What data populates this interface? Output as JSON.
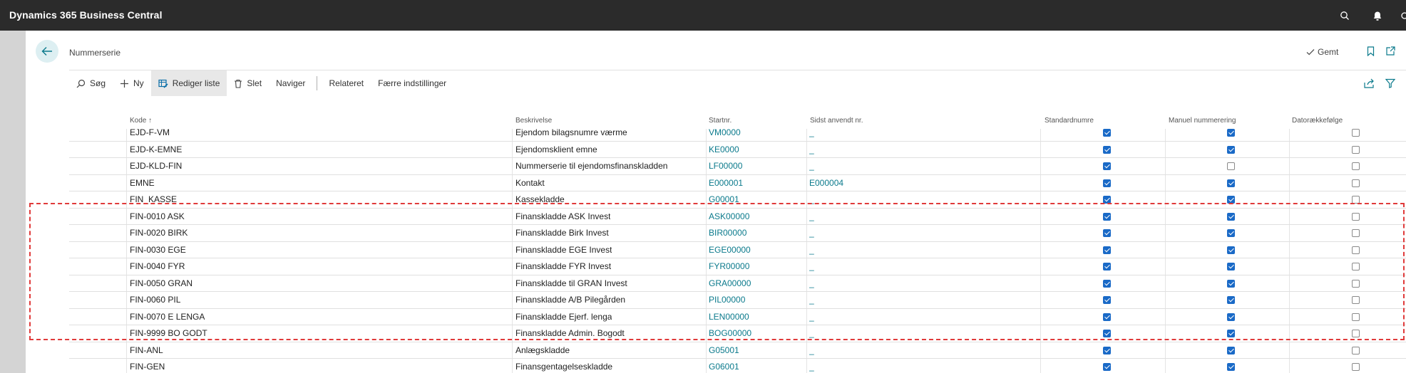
{
  "app": {
    "title": "Dynamics 365 Business Central"
  },
  "topbar_icons": [
    "search-icon",
    "bell-icon",
    "more-icon"
  ],
  "page": {
    "title": "Nummerserie",
    "saved_label": "Gemt"
  },
  "actions": {
    "search": "Søg",
    "new": "Ny",
    "edit_list": "Rediger liste",
    "delete": "Slet",
    "navigate": "Naviger",
    "related": "Relateret",
    "fewer_options": "Færre indstillinger"
  },
  "columns": {
    "code": "Kode",
    "sort_indicator": "↑",
    "description": "Beskrivelse",
    "start_no": "Startnr.",
    "last_used": "Sidst anvendt nr.",
    "default_nos": "Standardnumre",
    "manual_nos": "Manuel nummerering",
    "date_order": "Datorækkefølge"
  },
  "rows": [
    {
      "code": "EJD-F-VM",
      "description": "Ejendom bilagsnumre værme",
      "start_no": "VM0000",
      "last_used": "_",
      "default": true,
      "manual": true,
      "date_order": false
    },
    {
      "code": "EJD-K-EMNE",
      "description": "Ejendomsklient emne",
      "start_no": "KE0000",
      "last_used": "_",
      "default": true,
      "manual": true,
      "date_order": false
    },
    {
      "code": "EJD-KLD-FIN",
      "description": "Nummerserie til ejendomsfinanskladden",
      "start_no": "LF00000",
      "last_used": "_",
      "default": true,
      "manual": false,
      "date_order": false
    },
    {
      "code": "EMNE",
      "description": "Kontakt",
      "start_no": "E000001",
      "last_used": "E000004",
      "default": true,
      "manual": true,
      "date_order": false
    },
    {
      "code": "FIN_KASSE",
      "description": "Kassekladde",
      "start_no": "G00001",
      "last_used": "_",
      "default": true,
      "manual": true,
      "date_order": false
    },
    {
      "code": "FIN-0010 ASK",
      "description": "Finanskladde ASK Invest",
      "start_no": "ASK00000",
      "last_used": "_",
      "default": true,
      "manual": true,
      "date_order": false
    },
    {
      "code": "FIN-0020 BIRK",
      "description": "Finanskladde Birk Invest",
      "start_no": "BIR00000",
      "last_used": "_",
      "default": true,
      "manual": true,
      "date_order": false
    },
    {
      "code": "FIN-0030 EGE",
      "description": "Finanskladde EGE Invest",
      "start_no": "EGE00000",
      "last_used": "_",
      "default": true,
      "manual": true,
      "date_order": false
    },
    {
      "code": "FIN-0040 FYR",
      "description": "Finanskladde FYR Invest",
      "start_no": "FYR00000",
      "last_used": "_",
      "default": true,
      "manual": true,
      "date_order": false
    },
    {
      "code": "FIN-0050 GRAN",
      "description": "Finanskladde til GRAN Invest",
      "start_no": "GRA00000",
      "last_used": "_",
      "default": true,
      "manual": true,
      "date_order": false
    },
    {
      "code": "FIN-0060 PIL",
      "description": "Finanskladde A/B Pilegården",
      "start_no": "PIL00000",
      "last_used": "_",
      "default": true,
      "manual": true,
      "date_order": false
    },
    {
      "code": "FIN-0070 E LENGA",
      "description": "Finanskladde Ejerf. lenga",
      "start_no": "LEN00000",
      "last_used": "_",
      "default": true,
      "manual": true,
      "date_order": false
    },
    {
      "code": "FIN-9999 BO GODT",
      "description": "Finanskladde Admin. Bogodt",
      "start_no": "BOG00000",
      "last_used": "_",
      "default": true,
      "manual": true,
      "date_order": false
    },
    {
      "code": "FIN-ANL",
      "description": "Anlægskladde",
      "start_no": "G05001",
      "last_used": "_",
      "default": true,
      "manual": true,
      "date_order": false
    },
    {
      "code": "FIN-GEN",
      "description": "Finansgentagelseskladde",
      "start_no": "G06001",
      "last_used": "_",
      "default": true,
      "manual": true,
      "date_order": false
    }
  ],
  "colors": {
    "topbar": "#2b2b2b",
    "link": "#0b7a8c",
    "checkbox": "#1a6ac7",
    "highlight": "#e03a3a"
  }
}
